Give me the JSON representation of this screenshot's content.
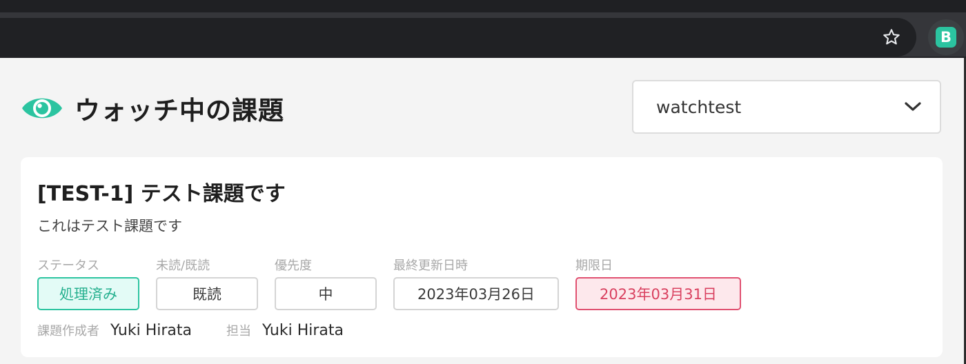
{
  "browser": {
    "extension_letter": "B"
  },
  "header": {
    "title": "ウォッチ中の課題",
    "project_select": {
      "selected": "watchtest"
    }
  },
  "issue": {
    "title": "[TEST-1] テスト課題です",
    "description": "これはテスト課題です",
    "fields": {
      "status": {
        "label": "ステータス",
        "value": "処理済み"
      },
      "read": {
        "label": "未読/既読",
        "value": "既読"
      },
      "priority": {
        "label": "優先度",
        "value": "中"
      },
      "updated": {
        "label": "最終更新日時",
        "value": "2023年03月26日"
      },
      "due": {
        "label": "期限日",
        "value": "2023年03月31日"
      }
    },
    "creator": {
      "label": "課題作成者",
      "name": "Yuki Hirata"
    },
    "assignee": {
      "label": "担当",
      "name": "Yuki Hirata"
    }
  },
  "colors": {
    "accent": "#2bc4a0",
    "due_alert": "#e05070"
  }
}
